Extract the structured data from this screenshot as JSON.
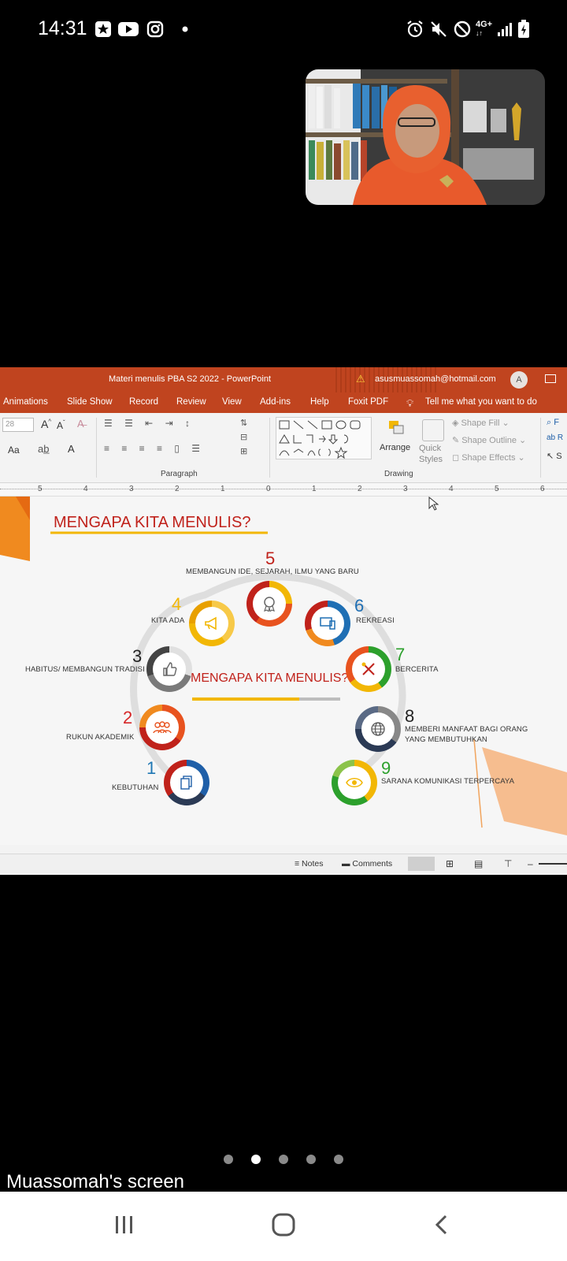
{
  "status": {
    "time": "14:31",
    "network": "4G+"
  },
  "ppt": {
    "window_title": "Materi menulis PBA S2 2022  -  PowerPoint",
    "account_email": "asusmuassomah@hotmail.com",
    "avatar_initial": "A",
    "menu": [
      "Animations",
      "Slide Show",
      "Record",
      "Review",
      "View",
      "Add-ins",
      "Help",
      "Foxit PDF"
    ],
    "tell_me": "Tell me what you want to do",
    "ribbon": {
      "font_size": "28",
      "paragraph_label": "Paragraph",
      "drawing_label": "Drawing",
      "arrange_label": "Arrange",
      "quick_styles_label": "Quick Styles",
      "shape_fill": "Shape Fill",
      "shape_outline": "Shape Outline",
      "shape_effects": "Shape Effects",
      "aa_label": "Aa"
    },
    "ruler": [
      "5",
      "4",
      "3",
      "2",
      "1",
      "0",
      "1",
      "2",
      "3",
      "4",
      "5",
      "6"
    ],
    "status": {
      "notes": "Notes",
      "comments": "Comments"
    }
  },
  "slide": {
    "title": "MENGAPA KITA MENULIS?",
    "center_title": "MENGAPA KITA MENULIS?",
    "nodes": [
      {
        "num": "1",
        "label": "KEBUTUHAN",
        "color": "#1f77b4"
      },
      {
        "num": "2",
        "label": "RUKUN AKADEMIK",
        "color": "#d62728"
      },
      {
        "num": "3",
        "label": "HABITUS/ MEMBANGUN TRADISI",
        "color": "#333333"
      },
      {
        "num": "4",
        "label": "KITA ADA",
        "color": "#f2b705"
      },
      {
        "num": "5",
        "label": "MEMBANGUN IDE, SEJARAH, ILMU YANG BARU",
        "color": "#c0221b"
      },
      {
        "num": "6",
        "label": "REKREASI",
        "color": "#1f6fb4"
      },
      {
        "num": "7",
        "label": "BERCERITA",
        "color": "#2ca02c"
      },
      {
        "num": "8",
        "label_line1": "MEMBERI MANFAAT BAGI ORANG",
        "label_line2": "YANG MEMBUTUHKAN",
        "color": "#333333"
      },
      {
        "num": "9",
        "label": "SARANA KOMUNIKASI TERPERCAYA",
        "color": "#2ca02c"
      }
    ]
  },
  "share_label": "Muassomah's screen"
}
